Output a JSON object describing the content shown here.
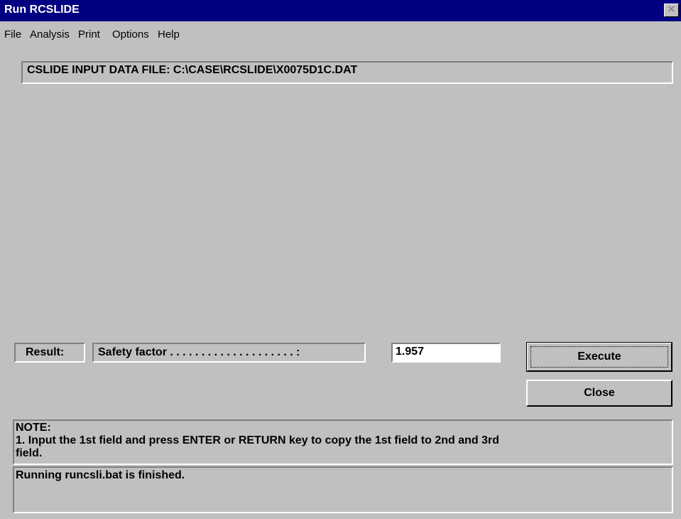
{
  "window": {
    "title": "Run RCSLIDE",
    "close_glyph": "✕"
  },
  "menu": [
    "File",
    "Analysis",
    "Print",
    "Options",
    "Help"
  ],
  "input_file_text": "CSLIDE INPUT DATA FILE: C:\\CASE\\RCSLIDE\\X0075D1C.DAT",
  "result": {
    "label": "Result:",
    "field_label": "Safety factor . . . . . . . . . . . . . . . . . . . . :",
    "value": "1.957"
  },
  "buttons": {
    "execute": "Execute",
    "close": "Close"
  },
  "note": {
    "heading": "NOTE:",
    "line1": "1. Input the 1st field and press ENTER or RETURN key to copy the 1st field to 2nd and 3rd",
    "line2": "field."
  },
  "status_text": "Running runcsli.bat is finished.",
  "colors": {
    "titlebar": "#000080",
    "face": "#c0c0c0"
  },
  "icons": {
    "close": "close-icon"
  }
}
